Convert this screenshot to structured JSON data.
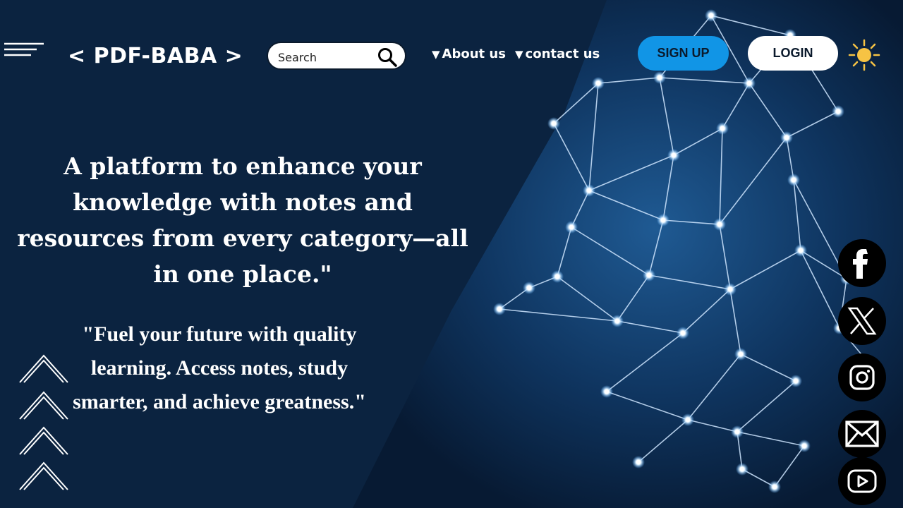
{
  "header": {
    "logo_text": "< PDF-BABA >",
    "search": {
      "placeholder": "Search"
    },
    "nav": [
      {
        "label": "About us"
      },
      {
        "label": "contact us"
      }
    ],
    "signup_label": "SIGN UP",
    "login_label": "LOGIN"
  },
  "hero": {
    "headline": "A platform to enhance your knowledge with notes and resources from every category—all in one place.\"",
    "quote": "\"Fuel your future with quality learning. Access notes, study smarter, and achieve greatness.\""
  },
  "icons": {
    "menu": "hamburger-menu-icon",
    "search": "search-icon",
    "theme": "sun-icon",
    "scroll": "chevron-up-icon",
    "social": [
      "facebook-icon",
      "x-icon",
      "instagram-icon",
      "mail-icon",
      "youtube-icon"
    ]
  },
  "colors": {
    "background": "#0b2340",
    "signup": "#1195e6",
    "login": "#ffffff",
    "sun": "#f6c344"
  }
}
